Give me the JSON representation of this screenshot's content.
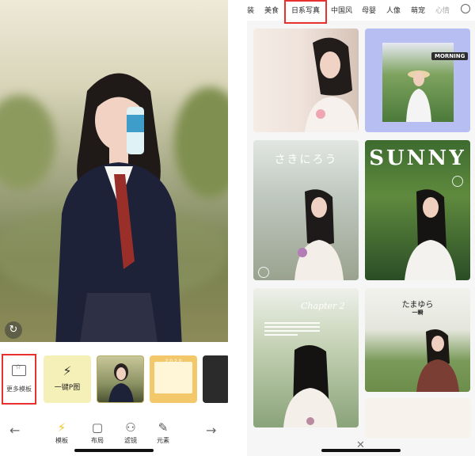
{
  "left_phone": {
    "more_templates_label": "更多模板",
    "onekey_template_label": "一键P图",
    "yellow_template_text": "2 0 2 0",
    "bottom_nav": [
      {
        "label": "模板",
        "icon": "bolt-icon",
        "active": true
      },
      {
        "label": "布局",
        "icon": "layout-icon",
        "active": false
      },
      {
        "label": "滤镜",
        "icon": "filter-icon",
        "active": false
      },
      {
        "label": "元素",
        "icon": "sticker-icon",
        "active": false
      }
    ],
    "accent_color": "#f4c91f",
    "highlight_color": "#e8302f"
  },
  "right_phone": {
    "categories": [
      "装",
      "美食",
      "日系写真",
      "中国风",
      "母婴",
      "人像",
      "萌宠",
      "心情"
    ],
    "selected_category": "日系写真",
    "cards": {
      "card2_tag": "MORNING",
      "card3_title": "さきにろう",
      "card4_title": "SUNNY",
      "card5_title": "Chapter 2",
      "card6_title": "たまゆら",
      "card6_subtitle": "一瞬"
    },
    "close_symbol": "✕"
  }
}
